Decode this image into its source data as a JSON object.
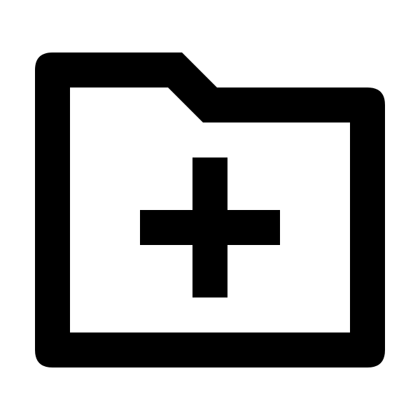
{
  "icon": {
    "name": "create-new-folder-icon",
    "color": "#000000",
    "background": "#ffffff"
  }
}
